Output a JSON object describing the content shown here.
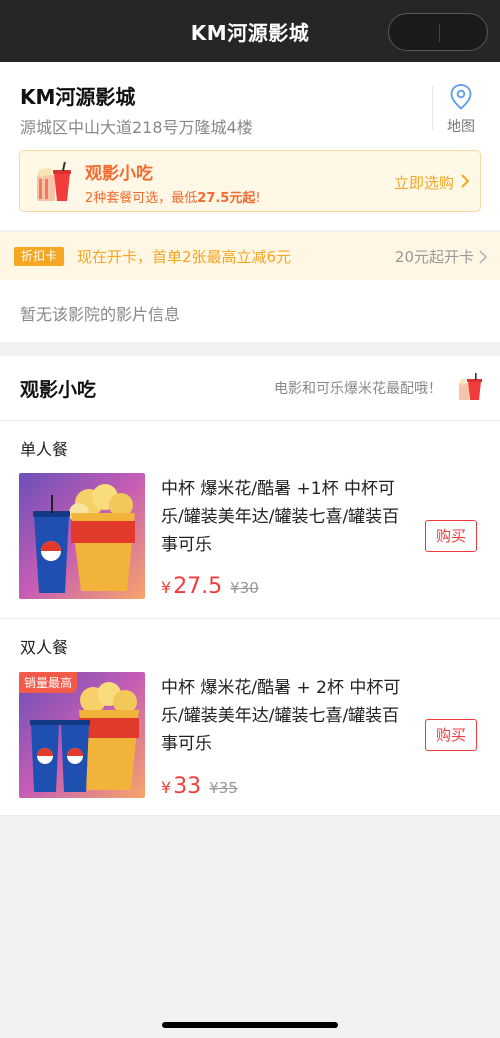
{
  "nav": {
    "title": "KM河源影城"
  },
  "cinema": {
    "name": "KM河源影城",
    "address": "源城区中山大道218号万隆城4楼",
    "map_label": "地图"
  },
  "snack_banner": {
    "title": "观影小吃",
    "desc_prefix": "2种套餐可选，最低",
    "desc_price": "27.5元起",
    "desc_suffix": "!",
    "action": "立即选购"
  },
  "discount": {
    "tag": "折扣卡",
    "text": "现在开卡，首单2张最高立减6元",
    "right": "20元起开卡"
  },
  "no_movie": "暂无该影院的影片信息",
  "snack_section": {
    "title": "观影小吃",
    "subtitle": "电影和可乐爆米花最配哦！",
    "groups": [
      {
        "label": "单人餐",
        "product": {
          "name": "中杯 爆米花/酷暑 +1杯 中杯可乐/罐装美年达/罐装七喜/罐装百事可乐",
          "currency": "¥",
          "price": "27.5",
          "original": "¥30",
          "buy": "购买"
        }
      },
      {
        "label": "双人餐",
        "product": {
          "badge": "销量最高",
          "name": "中杯 爆米花/酷暑 + 2杯 中杯可乐/罐装美年达/罐装七喜/罐装百事可乐",
          "currency": "¥",
          "price": "33",
          "original": "¥35",
          "buy": "购买"
        }
      }
    ]
  },
  "colors": {
    "accent_orange": "#f5a623",
    "price_red": "#f23c3c",
    "topbar": "#262626"
  },
  "icons": [
    "more-icon",
    "close-icon",
    "map-pin-icon",
    "snack-cup-icon",
    "chevron-right-icon"
  ]
}
